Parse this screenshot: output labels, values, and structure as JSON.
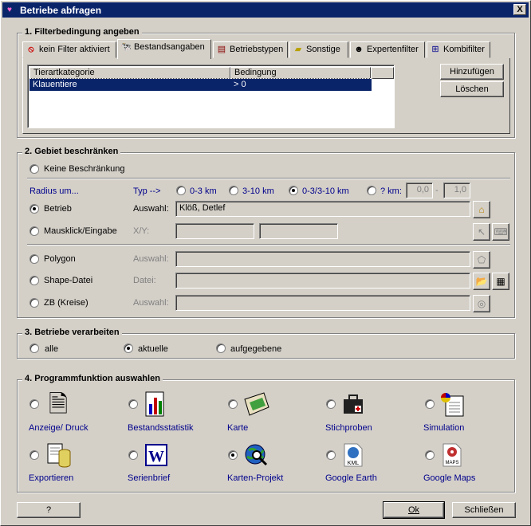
{
  "window": {
    "title": "Betriebe abfragen",
    "close": "X"
  },
  "g1": {
    "title": "1. Filterbedingung angeben",
    "tabs": [
      "kein Filter aktiviert",
      "Bestandsangaben",
      "Betriebstypen",
      "Sonstige",
      "Expertenfilter",
      "Kombifilter"
    ],
    "table": {
      "headers": [
        "Tierartkategorie",
        "Bedingung"
      ],
      "rows": [
        [
          "Klauentiere",
          "> 0"
        ]
      ]
    },
    "add": "Hinzufügen",
    "delete": "Löschen"
  },
  "g2": {
    "title": "2. Gebiet beschränken",
    "none": "Keine Beschränkung",
    "radius": "Radius um...",
    "typ": "Typ -->",
    "types": [
      "0-3 km",
      "3-10 km",
      "0-3/3-10 km",
      "? km:"
    ],
    "km_from": "0,0",
    "km_to": "1,0",
    "dash": "-",
    "betrieb": "Betrieb",
    "auswahl": "Auswahl:",
    "betrieb_value": "Klöß, Detlef",
    "maus": "Mausklick/Eingabe",
    "xy": "X/Y:",
    "polygon": "Polygon",
    "shape": "Shape-Datei",
    "datei": "Datei:",
    "zb": "ZB (Kreise)"
  },
  "g3": {
    "title": "3. Betriebe verarbeiten",
    "opts": [
      "alle",
      "aktuelle",
      "aufgegebene"
    ]
  },
  "g4": {
    "title": "4. Programmfunktion auswahlen",
    "items": [
      "Anzeige/ Druck",
      "Bestandsstatistik",
      "Karte",
      "Stichproben",
      "Simulation",
      "Exportieren",
      "Serienbrief",
      "Karten-Projekt",
      "Google Earth",
      "Google Maps"
    ]
  },
  "footer": {
    "help": "?",
    "ok": "Ok",
    "close": "Schließen"
  }
}
